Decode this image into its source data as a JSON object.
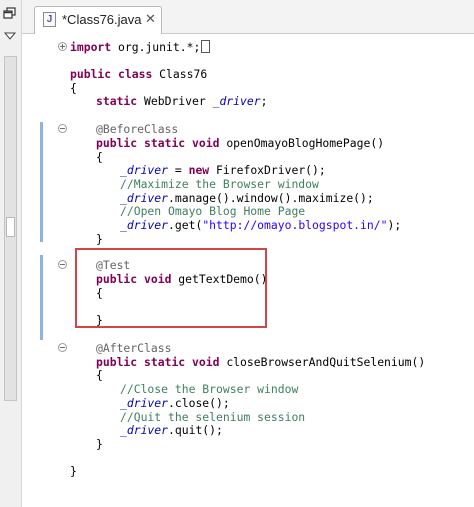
{
  "tab": {
    "title": "*Class76.java",
    "icon": "java-file-icon",
    "close_icon": "close-icon"
  },
  "side": {
    "restore_icon": "restore-window-icon",
    "menu_icon": "view-menu-icon"
  },
  "code": {
    "l_import": [
      "import",
      " org.junit.*;"
    ],
    "l_class": [
      "public",
      " ",
      "class",
      " Class76"
    ],
    "l_brace_open": "{",
    "l_field": [
      "static",
      " WebDriver ",
      "_driver",
      ";"
    ],
    "l_before_ann": "@BeforeClass",
    "l_open_sig": [
      "public",
      " ",
      "static",
      " ",
      "void",
      " openOmayoBlogHomePage()"
    ],
    "l_open_brace": "{",
    "l_new_driver": [
      "_driver",
      " = ",
      "new",
      " FirefoxDriver();"
    ],
    "l_comment_max": "//Maximize the Browser window",
    "l_maximize": [
      "_driver",
      ".manage().window().maximize();"
    ],
    "l_comment_open": "//Open Omayo Blog Home Page",
    "l_get": [
      "_driver",
      ".get(",
      "\"http://omayo.blogspot.in/\"",
      ");"
    ],
    "l_close_brace1": "}",
    "l_test_ann": "@Test",
    "l_test_sig": [
      "public",
      " ",
      "void",
      " getTextDemo()"
    ],
    "l_test_open": "{",
    "l_test_close": "}",
    "l_after_ann": "@AfterClass",
    "l_quit_sig": [
      "public",
      " ",
      "static",
      " ",
      "void",
      " closeBrowserAndQuitSelenium()"
    ],
    "l_quit_open": "{",
    "l_comment_close": "//Close the Browser window",
    "l_close_call": [
      "_driver",
      ".close();"
    ],
    "l_comment_quit": "//Quit the selenium session",
    "l_quit_call": [
      "_driver",
      ".quit();"
    ],
    "l_quit_close": "}",
    "l_class_close": "}"
  },
  "colors": {
    "keyword": "#7f0055",
    "annotation": "#646464",
    "field": "#0000c0",
    "comment": "#3f7f5f",
    "string": "#2a00ff",
    "highlight_box": "#d04545"
  }
}
